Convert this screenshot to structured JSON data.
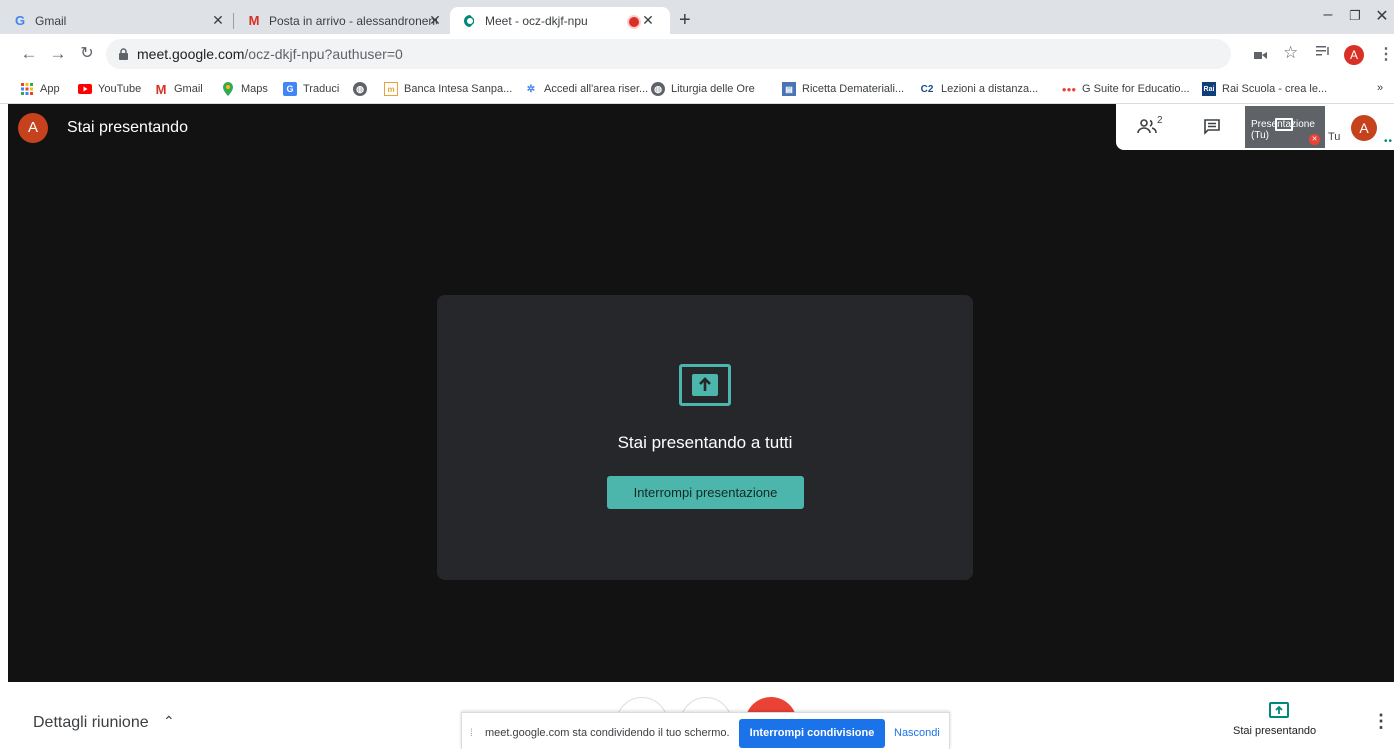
{
  "browser": {
    "tabs": [
      {
        "title": "Gmail",
        "favicon": "G"
      },
      {
        "title": "Posta in arrivo - alessandronencio",
        "favicon": "M"
      },
      {
        "title": "Meet - ocz-dkjf-npu",
        "favicon": "meet"
      }
    ],
    "new_tab": "+",
    "window_controls": {
      "minimize": "–",
      "maximize": "❐",
      "close": "✕"
    },
    "url_host": "meet.google.com",
    "url_path": "/ocz-dkjf-npu?authuser=0",
    "profile_initial": "A",
    "bookmarks": [
      {
        "label": "App",
        "icon": "apps-icon"
      },
      {
        "label": "YouTube",
        "icon": "youtube-icon"
      },
      {
        "label": "Gmail",
        "icon": "gmail-icon"
      },
      {
        "label": "Maps",
        "icon": "maps-icon"
      },
      {
        "label": "Traduci",
        "icon": "translate-icon"
      },
      {
        "label": "",
        "icon": "globe-icon"
      },
      {
        "label": "Banca Intesa Sanpa...",
        "icon": "bank-icon"
      },
      {
        "label": "Accedi all'area riser...",
        "icon": "star-icon"
      },
      {
        "label": "Liturgia delle Ore",
        "icon": "globe-icon"
      },
      {
        "label": "Ricetta Demateriali...",
        "icon": "doc-icon"
      },
      {
        "label": "Lezioni a distanza...",
        "icon": "c2-icon"
      },
      {
        "label": "G Suite for Educatio...",
        "icon": "gsuite-icon"
      },
      {
        "label": "Rai Scuola - crea le...",
        "icon": "rai-icon"
      }
    ],
    "bookmarks_more": "»"
  },
  "meet": {
    "presenter_initial": "A",
    "header_title": "Stai presentando",
    "participants_count": "2",
    "tile_label": "Presentazione (Tu)",
    "self_label": "Tu",
    "self_initial": "A",
    "card_title": "Stai presentando a tutti",
    "stop_presenting": "Interrompi presentazione",
    "meeting_details": "Dettagli riunione",
    "presenting_label": "Stai presentando",
    "share_notice": "meet.google.com sta condividendo il tuo schermo.",
    "stop_sharing": "Interrompi condivisione",
    "hide": "Nascondi"
  },
  "colors": {
    "accent": "#4db6ac",
    "stop_share_blue": "#1a73e8",
    "hangup_red": "#ea4335",
    "avatar_orange": "#c5421d"
  }
}
